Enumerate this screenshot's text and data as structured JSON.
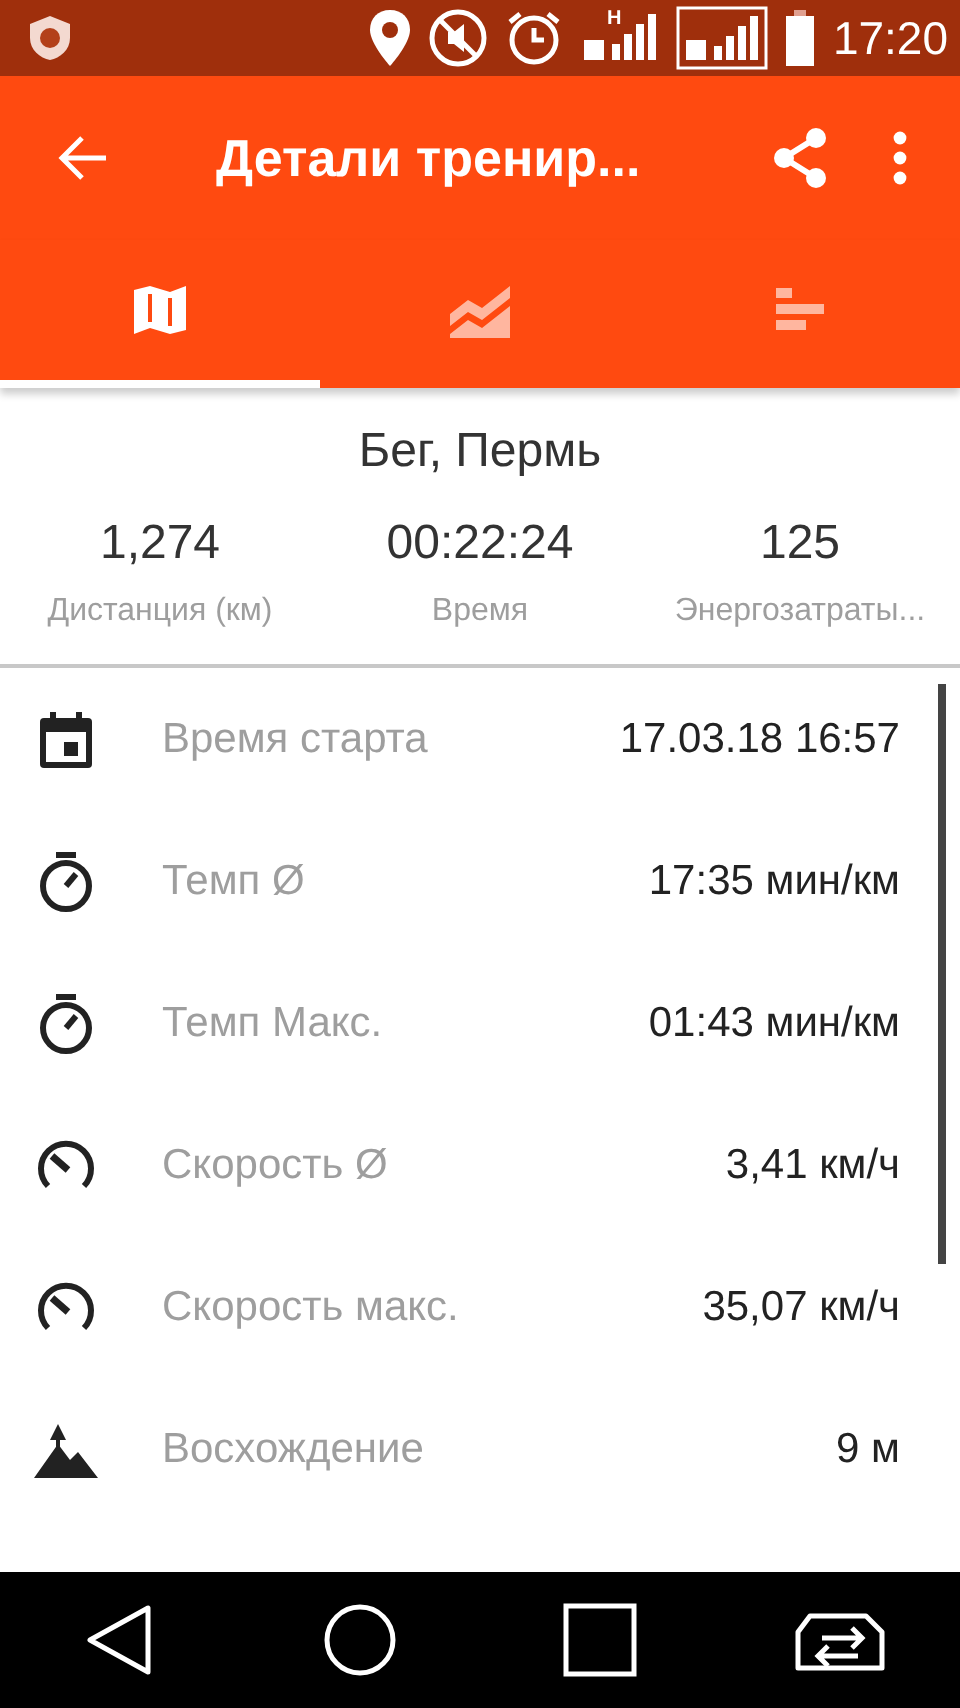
{
  "status_bar": {
    "time": "17:20",
    "sim_1_badge": "H"
  },
  "app_bar": {
    "title": "Детали тренир..."
  },
  "tabs": [
    {
      "kind": "map",
      "selected": true
    },
    {
      "kind": "chart",
      "selected": false
    },
    {
      "kind": "bars",
      "selected": false
    }
  ],
  "summary": {
    "title": "Бег, Пермь",
    "stats": [
      {
        "value": "1,274",
        "label": "Дистанция (км)"
      },
      {
        "value": "00:22:24",
        "label": "Время"
      },
      {
        "value": "125",
        "label": "Энергозатраты..."
      }
    ]
  },
  "details": [
    {
      "kind": "calendar",
      "label": "Время старта",
      "value": "17.03.18 16:57"
    },
    {
      "kind": "stopwatch",
      "label": "Темп Ø",
      "value": "17:35 мин/км"
    },
    {
      "kind": "stopwatch",
      "label": "Темп Макс.",
      "value": "01:43 мин/км"
    },
    {
      "kind": "speed",
      "label": "Скорость Ø",
      "value": "3,41 км/ч"
    },
    {
      "kind": "speed",
      "label": "Скорость макс.",
      "value": "35,07 км/ч"
    },
    {
      "kind": "ascent",
      "label": "Восхождение",
      "value": "9 м"
    }
  ]
}
